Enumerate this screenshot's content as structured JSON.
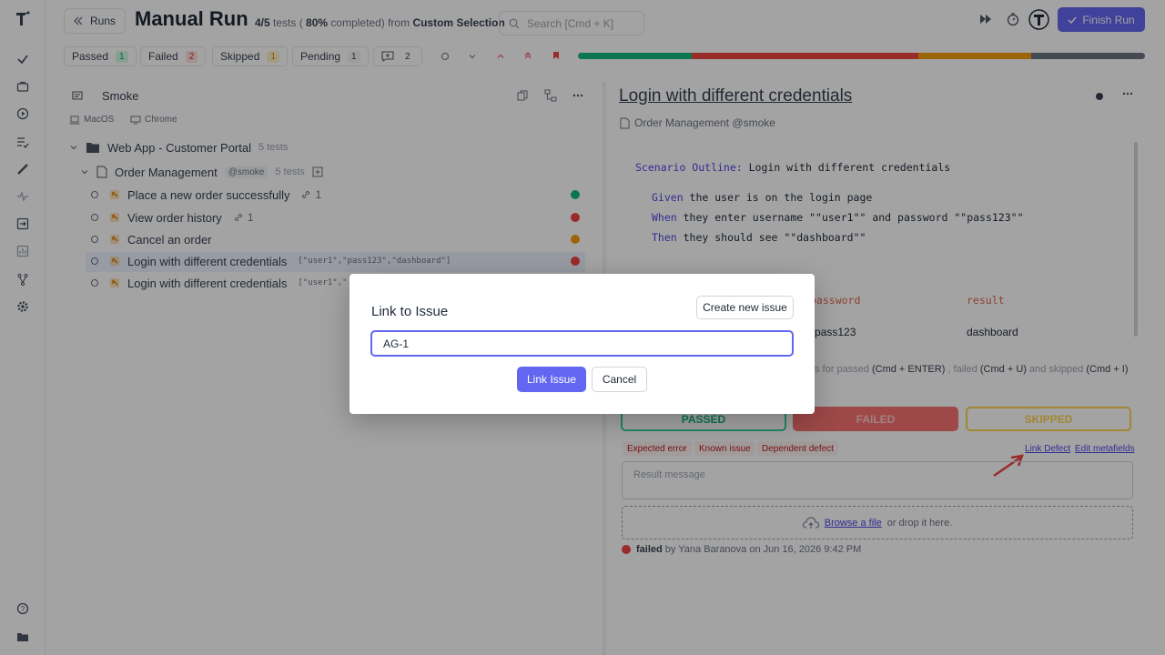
{
  "header": {
    "runs_label": "Runs",
    "title": "Manual Run",
    "progress_text": "4/5",
    "tests_text": " tests (",
    "percent_text": " 80%",
    "completed_text": " completed) from ",
    "selection_text": "Custom Selection",
    "search_placeholder": "Search [Cmd + K]",
    "finish_label": "Finish Run"
  },
  "status_filters": [
    {
      "label": "Passed",
      "count": "1"
    },
    {
      "label": "Failed",
      "count": "2"
    },
    {
      "label": "Skipped",
      "count": "1"
    },
    {
      "label": "Pending",
      "count": "1"
    }
  ],
  "comments_count": "2",
  "progress_bar": {
    "passed": 0.2,
    "failed": 0.4,
    "skipped": 0.2,
    "pending": 0.2,
    "colors": {
      "passed": "#10b981",
      "failed": "#ef4444",
      "skipped": "#f59e0b",
      "pending": "#6b7280"
    }
  },
  "left_panel": {
    "suite_title": "Smoke",
    "env_macos": "MacOS",
    "env_chrome": "Chrome",
    "root_folder": "Web App - Customer Portal",
    "root_count": "5 tests",
    "sub_folder": "Order Management",
    "sub_tag": "@smoke",
    "sub_count": "5 tests",
    "tests": [
      {
        "name": "Place a new order successfully",
        "links": "1",
        "params": "",
        "status": "passed"
      },
      {
        "name": "View order history",
        "links": "1",
        "params": "",
        "status": "failed"
      },
      {
        "name": "Cancel an order",
        "links": "",
        "params": "",
        "status": "skipped"
      },
      {
        "name": "Login with different credentials",
        "links": "",
        "params": "[\"user1\",\"pass123\",\"dashboard\"]",
        "status": "failed"
      },
      {
        "name": "Login with different credentials",
        "links": "",
        "params": "[\"user1\",\"",
        "status": "pending"
      }
    ]
  },
  "right_panel": {
    "title": "Login with different credentials",
    "breadcrumb": "Order Management @smoke",
    "scenario_kw": "Scenario Outline:",
    "scenario_text": " Login with different credentials",
    "steps": [
      {
        "kw": "Given",
        "text": " the user is on the login page"
      },
      {
        "kw": "When",
        "text": " they enter username \"\"user1\"\" and password \"\"pass123\"\""
      },
      {
        "kw": "Then",
        "text": " they should see \"\"dashboard\"\""
      }
    ],
    "col_password": "password",
    "col_result": "result",
    "val_password": "pass123",
    "val_result": "dashboard",
    "shortcuts_prefix": "s for passed ",
    "sc_passed": "(Cmd + ENTER)",
    "sc_mid1": " , failed ",
    "sc_failed": "(Cmd + U)",
    "sc_mid2": " and skipped ",
    "sc_skipped": "(Cmd + I)",
    "passed_label": "PASSED",
    "failed_label": "FAILED",
    "skipped_label": "SKIPPED",
    "pills": [
      "Expected error",
      "Known issue",
      "Dependent defect"
    ],
    "link_defect": "Link Defect",
    "edit_metafields": "Edit metafields",
    "result_placeholder": "Result message",
    "browse_label": "Browse a file",
    "drop_text": " or drop it here.",
    "failed_word": "failed",
    "by_text": " by Yana Baranova on Jun 16, 2026 9:42 PM"
  },
  "modal": {
    "title": "Link to Issue",
    "create_label": "Create new issue",
    "input_value": "AG-1",
    "link_label": "Link Issue",
    "cancel_label": "Cancel"
  }
}
